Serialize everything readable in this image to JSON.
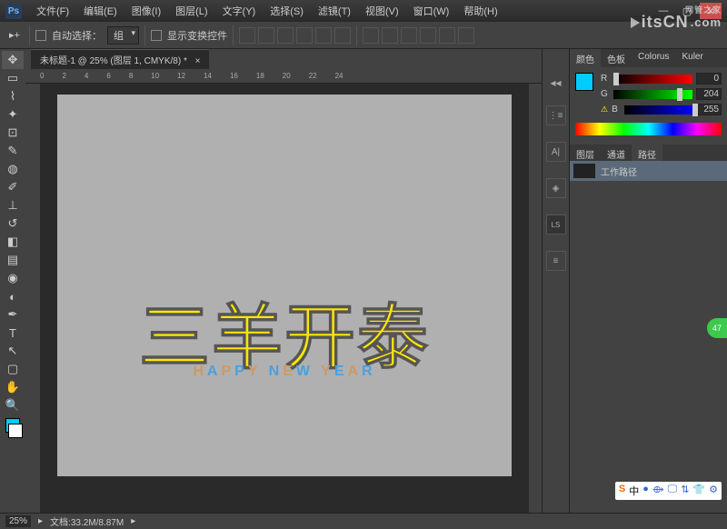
{
  "app": {
    "logo": "Ps"
  },
  "menu": [
    "文件(F)",
    "编辑(E)",
    "图像(I)",
    "图层(L)",
    "文字(Y)",
    "选择(S)",
    "滤镜(T)",
    "视图(V)",
    "窗口(W)",
    "帮助(H)"
  ],
  "options": {
    "auto_select_label": "自动选择：",
    "group_dropdown": "组",
    "show_transform_label": "显示变换控件"
  },
  "watermark": {
    "text": "itsCN",
    "suffix": ".com",
    "sub": "网管之家"
  },
  "doc_tab": {
    "title": "未标题-1 @ 25% (图层 1, CMYK/8) *"
  },
  "ruler_marks": [
    "0",
    "2",
    "4",
    "6",
    "8",
    "10",
    "12",
    "14",
    "16",
    "18",
    "20",
    "22",
    "24"
  ],
  "canvas": {
    "main_text": "三羊开泰",
    "sub_text": "HAPPY NEW YEAR"
  },
  "color_tabs": [
    "颜色",
    "色板",
    "Colorus",
    "Kuler"
  ],
  "channels": {
    "R": "0",
    "G": "204",
    "B": "255"
  },
  "panel_tabs": [
    "图层",
    "通道",
    "路径"
  ],
  "path_item": "工作路径",
  "status": {
    "zoom": "25%",
    "doc_info": "文档:33.2M/8.87M"
  },
  "badge": "47",
  "tray_items": [
    "S",
    "中",
    "●",
    "⟴",
    "🖵",
    "⇅",
    "👕",
    "⚙"
  ]
}
